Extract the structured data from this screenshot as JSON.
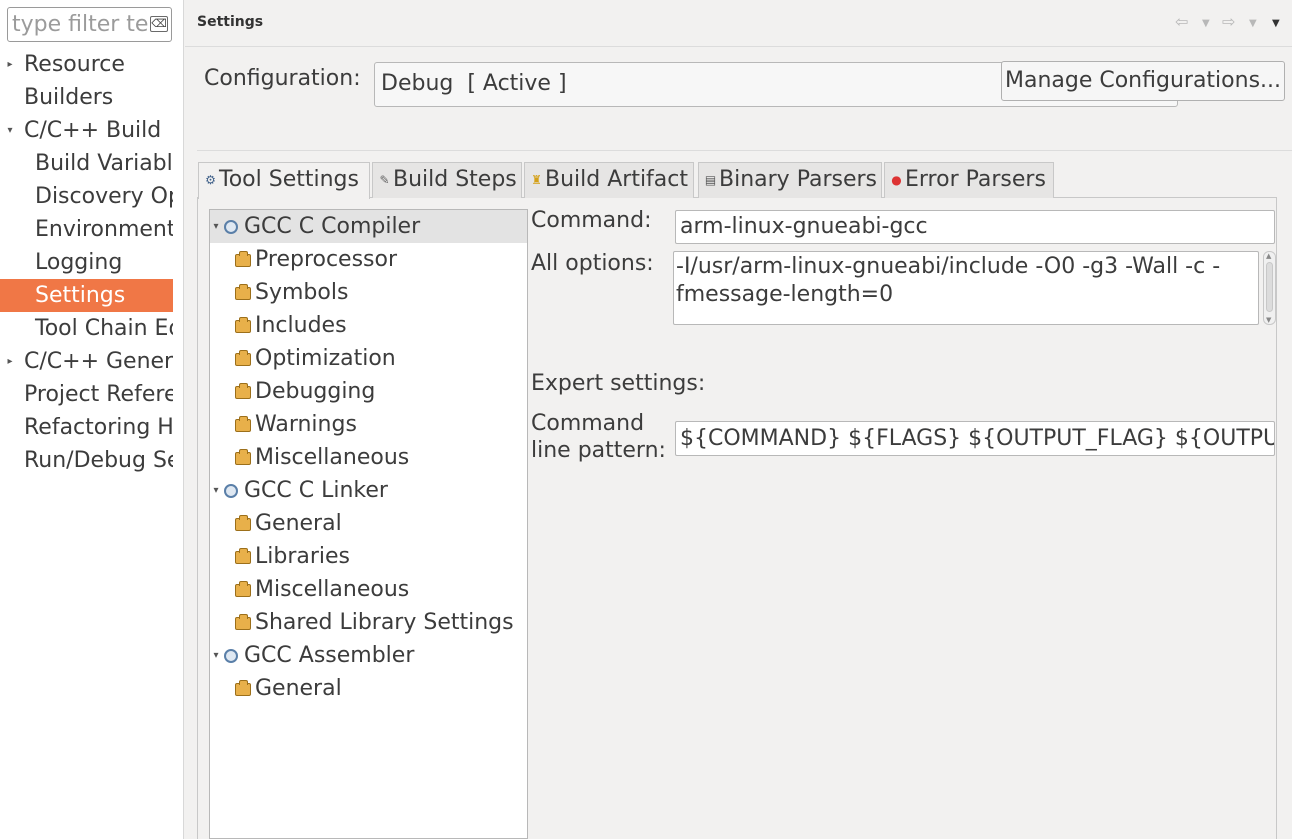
{
  "filter": {
    "placeholder": "type filter text",
    "clear_icon": "clear-filter-icon"
  },
  "left_nav": [
    {
      "label": "Resource",
      "expander": "collapsed"
    },
    {
      "label": "Builders",
      "expander": "none"
    },
    {
      "label": "C/C++ Build",
      "expander": "expanded"
    },
    {
      "label": "Build Variables",
      "expander": "none"
    },
    {
      "label": "Discovery Options",
      "expander": "none"
    },
    {
      "label": "Environment",
      "expander": "none"
    },
    {
      "label": "Logging",
      "expander": "none"
    },
    {
      "label": "Settings",
      "expander": "none",
      "selected": true
    },
    {
      "label": "Tool Chain Editor",
      "expander": "none"
    },
    {
      "label": "C/C++ General",
      "expander": "collapsed"
    },
    {
      "label": "Project References",
      "expander": "none"
    },
    {
      "label": "Refactoring History",
      "expander": "none"
    },
    {
      "label": "Run/Debug Settings",
      "expander": "none"
    }
  ],
  "header": {
    "title": "Settings"
  },
  "configuration": {
    "label": "Configuration:",
    "selected": "Debug  [ Active ]",
    "manage_button": "Manage Configurations..."
  },
  "tabs": [
    {
      "label": "Tool Settings",
      "icon": "tool-settings-icon",
      "active": true
    },
    {
      "label": "Build Steps",
      "icon": "build-steps-icon"
    },
    {
      "label": "Build Artifact",
      "icon": "build-artifact-icon"
    },
    {
      "label": "Binary Parsers",
      "icon": "binary-parsers-icon"
    },
    {
      "label": "Error Parsers",
      "icon": "error-parsers-icon"
    }
  ],
  "tree": [
    {
      "label": "GCC C Compiler",
      "type": "tool",
      "selected": true
    },
    {
      "label": "Preprocessor",
      "type": "option"
    },
    {
      "label": "Symbols",
      "type": "option"
    },
    {
      "label": "Includes",
      "type": "option"
    },
    {
      "label": "Optimization",
      "type": "option"
    },
    {
      "label": "Debugging",
      "type": "option"
    },
    {
      "label": "Warnings",
      "type": "option"
    },
    {
      "label": "Miscellaneous",
      "type": "option"
    },
    {
      "label": "GCC C Linker",
      "type": "tool"
    },
    {
      "label": "General",
      "type": "option"
    },
    {
      "label": "Libraries",
      "type": "option"
    },
    {
      "label": "Miscellaneous",
      "type": "option"
    },
    {
      "label": "Shared Library Settings",
      "type": "option"
    },
    {
      "label": "GCC Assembler",
      "type": "tool"
    },
    {
      "label": "General",
      "type": "option"
    }
  ],
  "details": {
    "command_label": "Command:",
    "command_value": "arm-linux-gnueabi-gcc",
    "all_options_label": "All options:",
    "all_options_value": "-I/usr/arm-linux-gnueabi/include -O0 -g3 -Wall -c -fmessage-length=0",
    "expert_label": "Expert settings:",
    "pattern_label_1": "Command",
    "pattern_label_2": "line pattern:",
    "pattern_value": "${COMMAND} ${FLAGS} ${OUTPUT_FLAG} ${OUTPUT_PREFIX}${OUTPUT} ${INPUTS}"
  }
}
